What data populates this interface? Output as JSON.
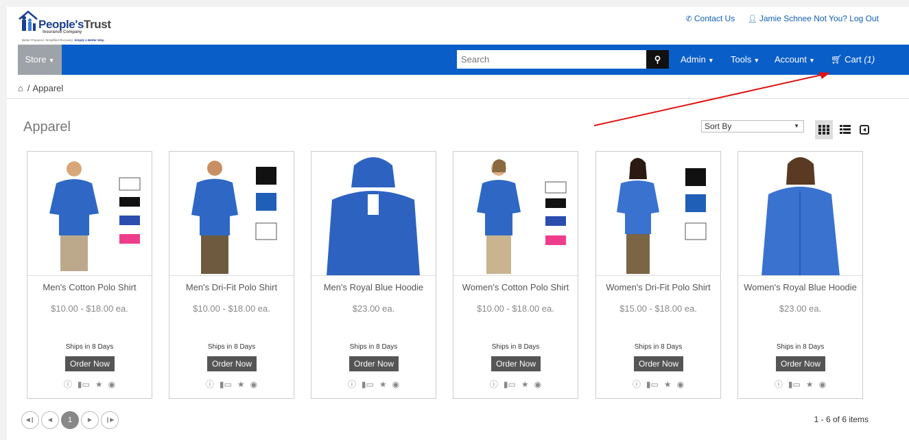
{
  "header": {
    "logo_name_1": "People's",
    "logo_name_2": "Trust",
    "logo_sub": "Insurance Company",
    "logo_tag_1": "Better Prepared. Simplified Recovery.",
    "logo_tag_2": "Simply a Better Way.",
    "contact_label": "Contact Us",
    "user_label": "Jamie Schnee Not You? Log Out"
  },
  "nav": {
    "store_label": "Store",
    "search_placeholder": "Search",
    "admin_label": "Admin",
    "tools_label": "Tools",
    "account_label": "Account",
    "cart_label": "Cart",
    "cart_count": "(1)"
  },
  "breadcrumb": {
    "current": "Apparel"
  },
  "main": {
    "title": "Apparel",
    "sort_label": "Sort By"
  },
  "products": [
    {
      "name": "Men's Cotton Polo Shirt",
      "price": "$10.00 - $18.00 ea.",
      "ships": "Ships in 8 Days",
      "order_label": "Order Now",
      "swatches": [
        "White",
        "Black",
        "Royal",
        "Tropical Pink"
      ]
    },
    {
      "name": "Men's Dri-Fit Polo Shirt",
      "price": "$10.00 - $18.00 ea.",
      "ships": "Ships in 8 Days",
      "order_label": "Order Now",
      "swatches": [
        "Black",
        "Royal Blue",
        "White"
      ]
    },
    {
      "name": "Men's Royal Blue Hoodie",
      "price": "$23.00 ea.",
      "ships": "Ships in 8 Days",
      "order_label": "Order Now",
      "swatches": []
    },
    {
      "name": "Women's Cotton Polo Shirt",
      "price": "$10.00 - $18.00 ea.",
      "ships": "Ships in 8 Days",
      "order_label": "Order Now",
      "swatches": [
        "White",
        "Black",
        "Royal",
        "Tropical Pink"
      ]
    },
    {
      "name": "Women's Dri-Fit Polo Shirt",
      "price": "$15.00 - $18.00 ea.",
      "ships": "Ships in 8 Days",
      "order_label": "Order Now",
      "swatches": [
        "Black",
        "Royal Blue",
        "White"
      ]
    },
    {
      "name": "Women's Royal Blue Hoodie",
      "price": "$23.00 ea.",
      "ships": "Ships in 8 Days",
      "order_label": "Order Now",
      "swatches": []
    }
  ],
  "pager": {
    "current_page": "1",
    "item_count": "1 - 6 of 6 items"
  },
  "colors": {
    "nav_blue": "#0a5ec8",
    "store_gray": "#9ea3a9",
    "button_gray": "#555555",
    "annotation_red": "#e01010",
    "shirt_blue": "#2e68c4"
  }
}
